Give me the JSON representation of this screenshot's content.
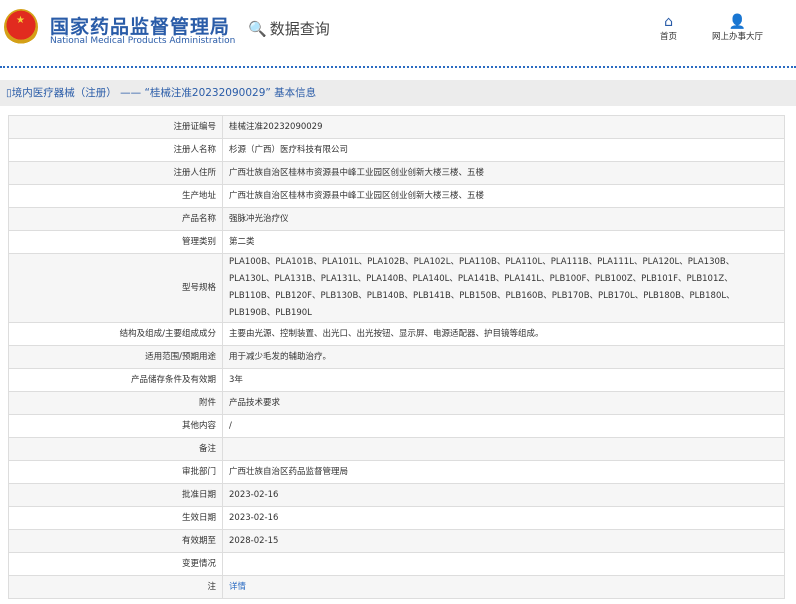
{
  "header": {
    "title_cn": "国家药品监督管理局",
    "title_en": "National Medical Products Administration",
    "query": "数据查询",
    "nav": [
      {
        "label": "首页",
        "icon": "home-icon"
      },
      {
        "label": "网上办事大厅",
        "icon": "user-icon"
      }
    ]
  },
  "breadcrumb": "境内医疗器械（注册） —— “桂械注准20232090029” 基本信息",
  "rows": [
    {
      "label": "注册证编号",
      "value": "桂械注准20232090029"
    },
    {
      "label": "注册人名称",
      "value": "杉源（广西）医疗科技有限公司"
    },
    {
      "label": "注册人住所",
      "value": "广西壮族自治区桂林市资源县中峰工业园区创业创新大楼三楼、五楼"
    },
    {
      "label": "生产地址",
      "value": "广西壮族自治区桂林市资源县中峰工业园区创业创新大楼三楼、五楼"
    },
    {
      "label": "产品名称",
      "value": "强脉冲光治疗仪"
    },
    {
      "label": "管理类别",
      "value": "第二类"
    },
    {
      "label": "型号规格",
      "value": "PLA100B、PLA101B、PLA101L、PLA102B、PLA102L、PLA110B、PLA110L、PLA111B、PLA111L、PLA120L、PLA130B、PLA130L、PLA131B、PLA131L、PLA140B、PLA140L、PLA141B、PLA141L、PLB100F、PLB100Z、PLB101F、PLB101Z、PLB110B、PLB120F、PLB130B、PLB140B、PLB141B、PLB150B、PLB160B、PLB170B、PLB170L、PLB180B、PLB180L、PLB190B、PLB190L"
    },
    {
      "label": "结构及组成/主要组成成分",
      "value": "主要由光源、控制装置、出光口、出光按钮、显示屏、电源适配器、护目镜等组成。"
    },
    {
      "label": "适用范围/预期用途",
      "value": "用于减少毛发的辅助治疗。"
    },
    {
      "label": "产品储存条件及有效期",
      "value": "3年"
    },
    {
      "label": "附件",
      "value": "产品技术要求"
    },
    {
      "label": "其他内容",
      "value": "/"
    },
    {
      "label": "备注",
      "value": ""
    },
    {
      "label": "审批部门",
      "value": "广西壮族自治区药品监督管理局"
    },
    {
      "label": "批准日期",
      "value": "2023-02-16"
    },
    {
      "label": "生效日期",
      "value": "2023-02-16"
    },
    {
      "label": "有效期至",
      "value": "2028-02-15"
    },
    {
      "label": "变更情况",
      "value": ""
    },
    {
      "label": "注",
      "value": "详情"
    }
  ]
}
